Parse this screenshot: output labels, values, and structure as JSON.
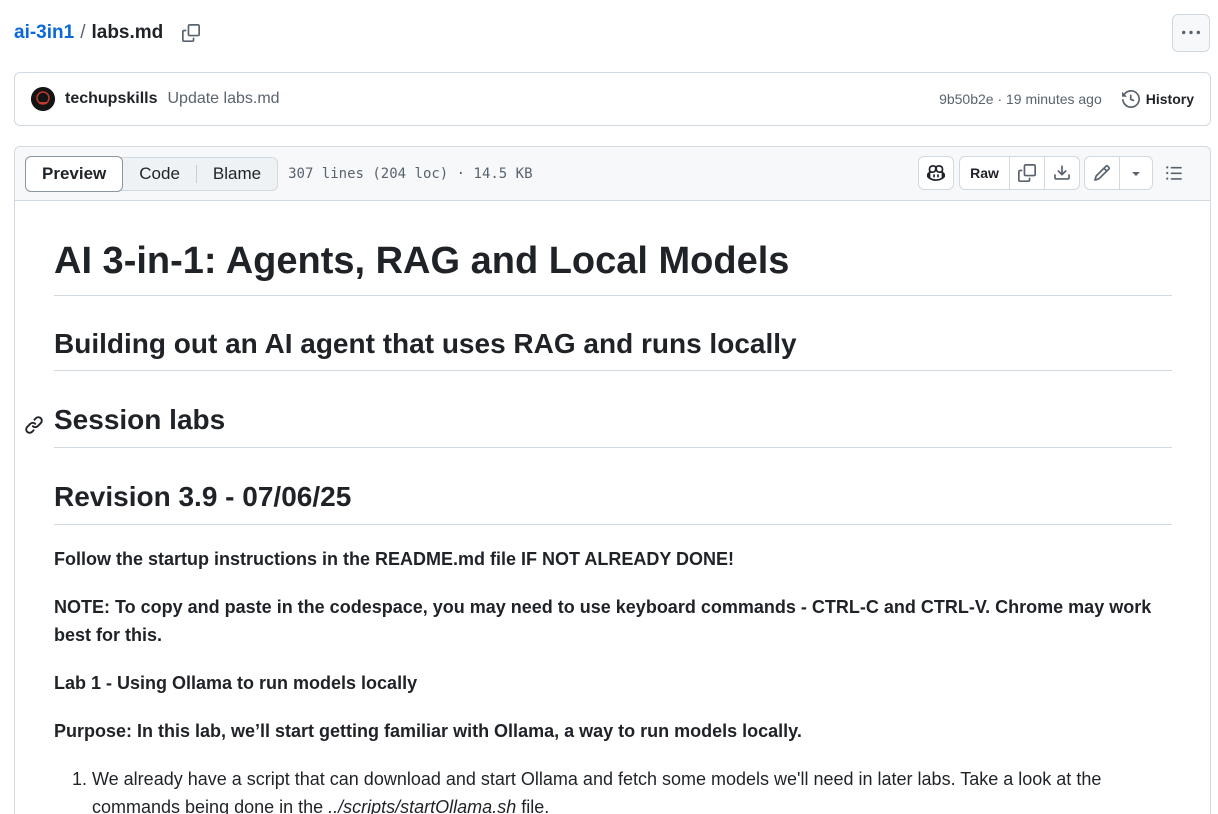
{
  "breadcrumb": {
    "repo": "ai-3in1",
    "separator": "/",
    "file": "labs.md"
  },
  "commit": {
    "author": "techupskills",
    "message": "Update labs.md",
    "meta": "9b50b2e · 19 minutes ago",
    "history_label": "History"
  },
  "file_header": {
    "tabs": [
      "Preview",
      "Code",
      "Blame"
    ],
    "active_tab": "Preview",
    "info": "307 lines (204 loc) · 14.5 KB",
    "raw_label": "Raw"
  },
  "content": {
    "h1": "AI 3-in-1: Agents, RAG and Local Models",
    "h2_1": "Building out an AI agent that uses RAG and runs locally",
    "h2_2": "Session labs",
    "h2_3": "Revision 3.9 - 07/06/25",
    "p1": "Follow the startup instructions in the README.md file IF NOT ALREADY DONE!",
    "p2": "NOTE: To copy and paste in the codespace, you may need to use keyboard commands - CTRL-C and CTRL-V. Chrome may work best for this.",
    "p3": "Lab 1 - Using Ollama to run models locally",
    "p4": "Purpose: In this lab, we’ll start getting familiar with Ollama, a way to run models locally.",
    "li1_before": "We already have a script that can download and start Ollama and fetch some models we'll need in later labs. Take a look at the commands being done in the ",
    "li1_path": "../scripts/startOllama.sh",
    "li1_after": " file."
  },
  "icons": {
    "copy": "copy-icon",
    "more": "kebab-horizontal-icon",
    "history": "history-icon",
    "copilot": "copilot-icon",
    "download": "download-icon",
    "edit": "pencil-icon",
    "dropdown": "triangle-down-icon",
    "outline": "list-unordered-icon",
    "anchor": "link-icon"
  }
}
